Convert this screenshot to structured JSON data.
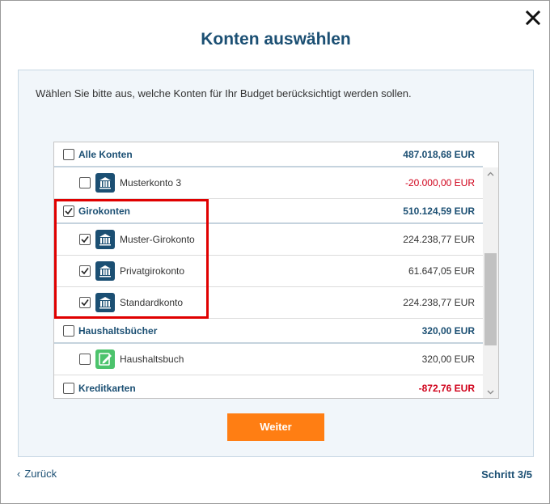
{
  "dialog": {
    "title": "Konten auswählen",
    "intro": "Wählen Sie bitte aus, welche Konten für Ihr Budget berücksichtigt werden sollen.",
    "next_label": "Weiter",
    "back_label": "Zurück",
    "step_label": "Schritt 3/5"
  },
  "colors": {
    "accent": "#1b4f73",
    "orange": "#ff7e13",
    "negative": "#d0021b",
    "highlight": "#e00000",
    "book_icon": "#4cc36c"
  },
  "accounts": {
    "all": {
      "label": "Alle Konten",
      "amount": "487.018,68 EUR",
      "checked": false
    },
    "muster3": {
      "label": "Musterkonto 3",
      "amount": "-20.000,00 EUR",
      "checked": false,
      "icon": "bank-icon"
    },
    "giro": {
      "label": "Girokonten",
      "amount": "510.124,59 EUR",
      "checked": true
    },
    "mustergiro": {
      "label": "Muster-Girokonto",
      "amount": "224.238,77 EUR",
      "checked": true,
      "icon": "bank-icon"
    },
    "privat": {
      "label": "Privatgirokonto",
      "amount": "61.647,05 EUR",
      "checked": true,
      "icon": "bank-icon"
    },
    "standard": {
      "label": "Standardkonto",
      "amount": "224.238,77 EUR",
      "checked": true,
      "icon": "bank-icon"
    },
    "haushalt": {
      "label": "Haushaltsbücher",
      "amount": "320,00 EUR",
      "checked": false
    },
    "haushaltsbuch": {
      "label": "Haushaltsbuch",
      "amount": "320,00 EUR",
      "checked": false,
      "icon": "notebook-icon"
    },
    "kredit": {
      "label": "Kreditkarten",
      "amount": "-872,76 EUR",
      "checked": false
    }
  }
}
